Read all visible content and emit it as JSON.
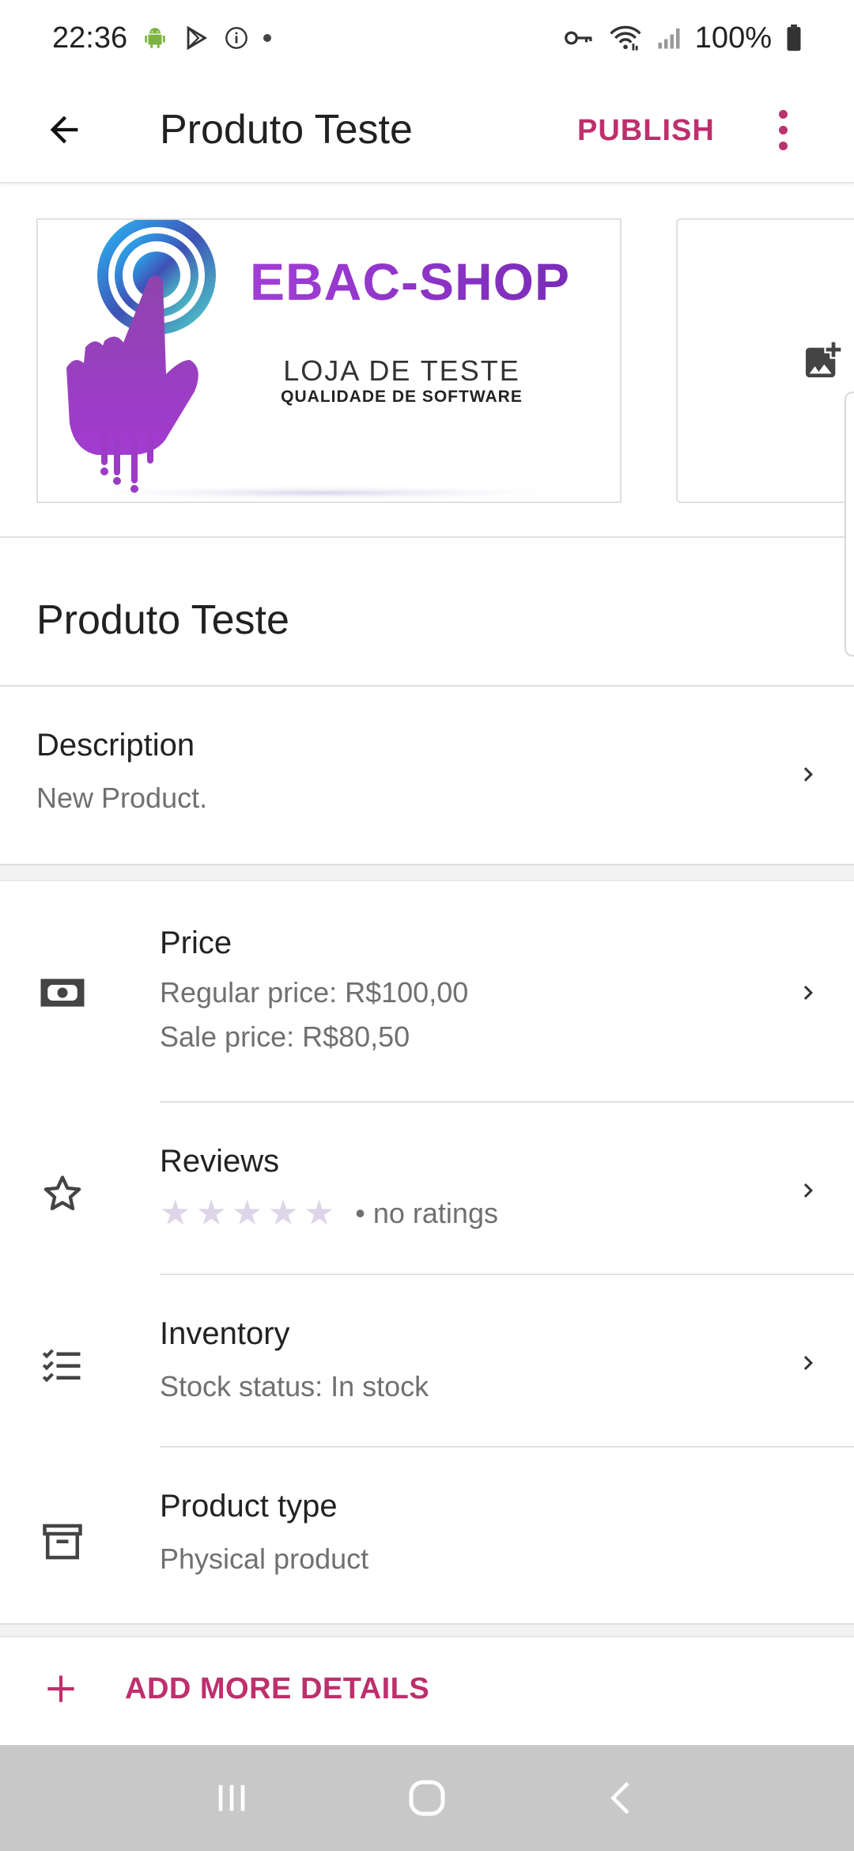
{
  "status_bar": {
    "time": "22:36",
    "battery": "100%"
  },
  "app_bar": {
    "title": "Produto Teste",
    "publish_label": "PUBLISH"
  },
  "images": {
    "logo_title": "EBAC-SHOP",
    "logo_line1": "LOJA DE TESTE",
    "logo_line2": "QUALIDADE DE SOFTWARE"
  },
  "product": {
    "title": "Produto Teste"
  },
  "description": {
    "title": "Description",
    "value": "New Product."
  },
  "details": {
    "price": {
      "title": "Price",
      "regular": "Regular price: R$100,00",
      "sale": "Sale price: R$80,50",
      "icon": "money-icon"
    },
    "reviews": {
      "title": "Reviews",
      "rating": 0,
      "max_rating": 5,
      "rating_text": "• no ratings",
      "icon": "star-outline-icon"
    },
    "inventory": {
      "title": "Inventory",
      "status": "Stock status: In stock",
      "icon": "checklist-icon"
    },
    "product_type": {
      "title": "Product type",
      "value": "Physical product",
      "icon": "archive-box-icon"
    }
  },
  "add_more": {
    "label": "ADD MORE DETAILS"
  },
  "colors": {
    "accent": "#be2f6d",
    "logo_purple": "#8b2fc2",
    "nav_bar": "#c8c8c8"
  }
}
